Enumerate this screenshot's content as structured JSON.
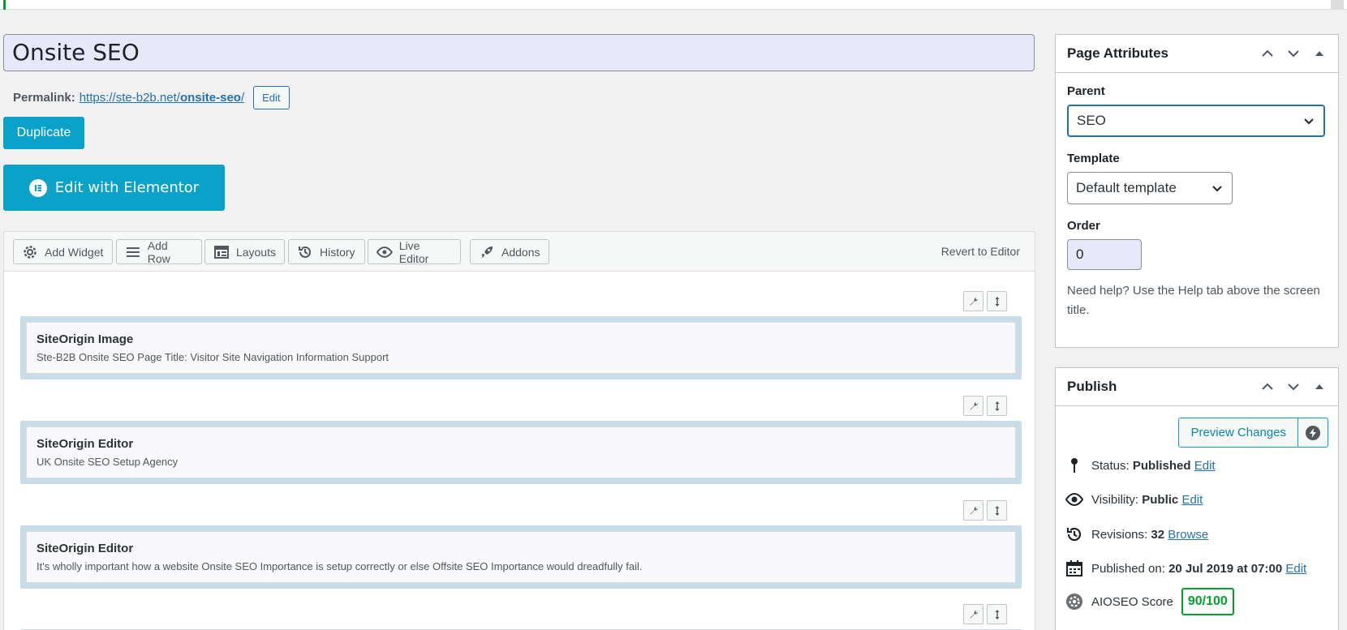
{
  "post": {
    "title": "Onsite SEO",
    "permalink_label": "Permalink:",
    "permalink_base": "https://ste-b2b.net/",
    "permalink_slug": "onsite-seo",
    "permalink_trailing": "/",
    "edit_label": "Edit"
  },
  "actions": {
    "duplicate_label": "Duplicate",
    "elementor_label": "Edit with Elementor"
  },
  "builder": {
    "toolbar": [
      {
        "label": "Add Widget",
        "icon": "gear-icon"
      },
      {
        "label": "Add Row",
        "icon": "lines-icon"
      },
      {
        "label": "Layouts",
        "icon": "layout-icon"
      },
      {
        "label": "History",
        "icon": "history-icon"
      },
      {
        "label": "Live Editor",
        "icon": "eye-icon"
      },
      {
        "label": "Addons",
        "icon": "rocket-icon"
      }
    ],
    "revert_label": "Revert to Editor",
    "rows": [
      {
        "title": "SiteOrigin Image",
        "desc": "Ste-B2B Onsite SEO Page Title: Visitor Site Navigation Information Support"
      },
      {
        "title": "SiteOrigin Editor",
        "desc": "UK Onsite SEO Setup Agency"
      },
      {
        "title": "SiteOrigin Editor",
        "desc": "It's wholly important how a website Onsite SEO Importance is setup correctly or else Offsite SEO Importance would dreadfully fail."
      }
    ]
  },
  "page_attributes": {
    "title": "Page Attributes",
    "parent_label": "Parent",
    "parent_value": "SEO",
    "template_label": "Template",
    "template_value": "Default template",
    "order_label": "Order",
    "order_value": "0",
    "help_text": "Need help? Use the Help tab above the screen title."
  },
  "publish": {
    "title": "Publish",
    "preview_label": "Preview Changes",
    "status_label": "Status:",
    "status_value": "Published",
    "visibility_label": "Visibility:",
    "visibility_value": "Public",
    "revisions_label": "Revisions:",
    "revisions_value": "32",
    "browse_label": "Browse",
    "published_on_label": "Published on:",
    "published_on_value": "20 Jul 2019 at 07:00",
    "edit_label": "Edit",
    "aioseo_label": "AIOSEO Score",
    "aioseo_value": "90/100"
  },
  "colors": {
    "accent": "#0ba2c9",
    "link": "#2271b1",
    "score": "#00a32a"
  }
}
